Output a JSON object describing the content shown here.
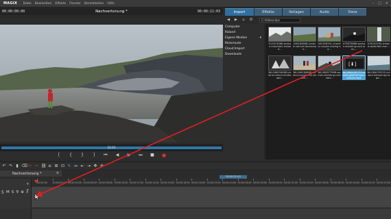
{
  "menubar": {
    "logo": "MAGIX",
    "items": [
      "Datei",
      "Bearbeiten",
      "Effekte",
      "Fenster",
      "Bereitstellen",
      "Hilfe"
    ],
    "window_buttons": [
      "–",
      "□",
      "✕"
    ]
  },
  "preview": {
    "timecode_left": "00:00:00:00",
    "title": "Nachvertonung *",
    "timecode_right": "00:00:21:03",
    "scrub_label": "21:03"
  },
  "transport": {
    "buttons": [
      "[",
      "{",
      "}",
      "]",
      "⏮",
      "◀",
      "▶",
      "⏭",
      "■",
      "●"
    ]
  },
  "panel": {
    "tabs": [
      "Import",
      "Effekte",
      "Vorlagen",
      "Audio",
      "Store"
    ],
    "toolbar_icons": [
      "◀",
      "▶",
      "⌂",
      "⚙"
    ],
    "path": "C:\\Videoclips",
    "sidebar": [
      {
        "label": "Computer",
        "chevron": ""
      },
      {
        "label": "Roland",
        "chevron": ""
      },
      {
        "label": "Eigene Medien",
        "chevron": "▾"
      },
      {
        "label": "Reiseroute",
        "chevron": ""
      },
      {
        "label": "Cloud Import",
        "chevron": ""
      },
      {
        "label": "Downloads",
        "chevron": ""
      }
    ],
    "thumbnails": [
      {
        "caption": "012413068-woman-mountain-iceland…",
        "selected": false
      },
      {
        "caption": "046184668-iceland-natural-landscape…",
        "selected": false
      },
      {
        "caption": "061308761-cheerful-couple-raising-ha…",
        "selected": false
      },
      {
        "caption": "075879668-woman-standing-rock-wav…",
        "selected": false
      },
      {
        "caption": "076241295-iceland-waterfall-river…",
        "selected": false
      },
      {
        "caption": "NK-046034068-iceland-nature-landscape…",
        "selected": false
      },
      {
        "caption": "NK-046184668-iceland-couple-fun-beach…",
        "selected": false
      },
      {
        "caption": "NK-065877968-woman-standing-rock-wav…",
        "selected": false
      },
      {
        "caption": "NK-084404225-iceland-geothermal-volcano.mp4",
        "selected": true
      },
      {
        "caption": "NK-084076152-iceland-hotsprings-lago…",
        "selected": false
      }
    ]
  },
  "timeline": {
    "track_tab": "Nachvertonung *",
    "close": "×",
    "ruler_timecode": "00:00:21:03",
    "ruler_labels": [
      "00:00:00",
      "00:00:02:00",
      "00:00:04:00",
      "00:00:06:00",
      "00:00:08:00",
      "00:00:10:00",
      "00:00:12:00",
      "00:00:14:00",
      "00:00:16:00",
      "00:00:18:00",
      "00:00:20:00",
      "00:00:22:00",
      "00:00:24:00",
      "00:00:26:00",
      "00:00:28:00",
      "00:00:30:00",
      "00:00:32:00",
      "00:00:34:00",
      "00:00:36:00",
      "00:00:38:00",
      "00:00:40:00",
      "00:00:42:00",
      "00:00:44:00"
    ],
    "track_number": "5",
    "track_controls": [
      "M",
      "S",
      "⚲",
      "⊕",
      "ↄ"
    ],
    "toolbar_icons": [
      "↶",
      "↷",
      "▮",
      "⌫",
      "✂",
      "✂",
      "⛓",
      "≡",
      "⊞",
      "⊡",
      "↖",
      "↔",
      "⇤",
      "⇥",
      "✥",
      "⊗"
    ]
  },
  "colors": {
    "accent": "#2f6fa0",
    "selection": "#4ea6d8",
    "arrow": "#e02020",
    "record": "#e23030"
  }
}
